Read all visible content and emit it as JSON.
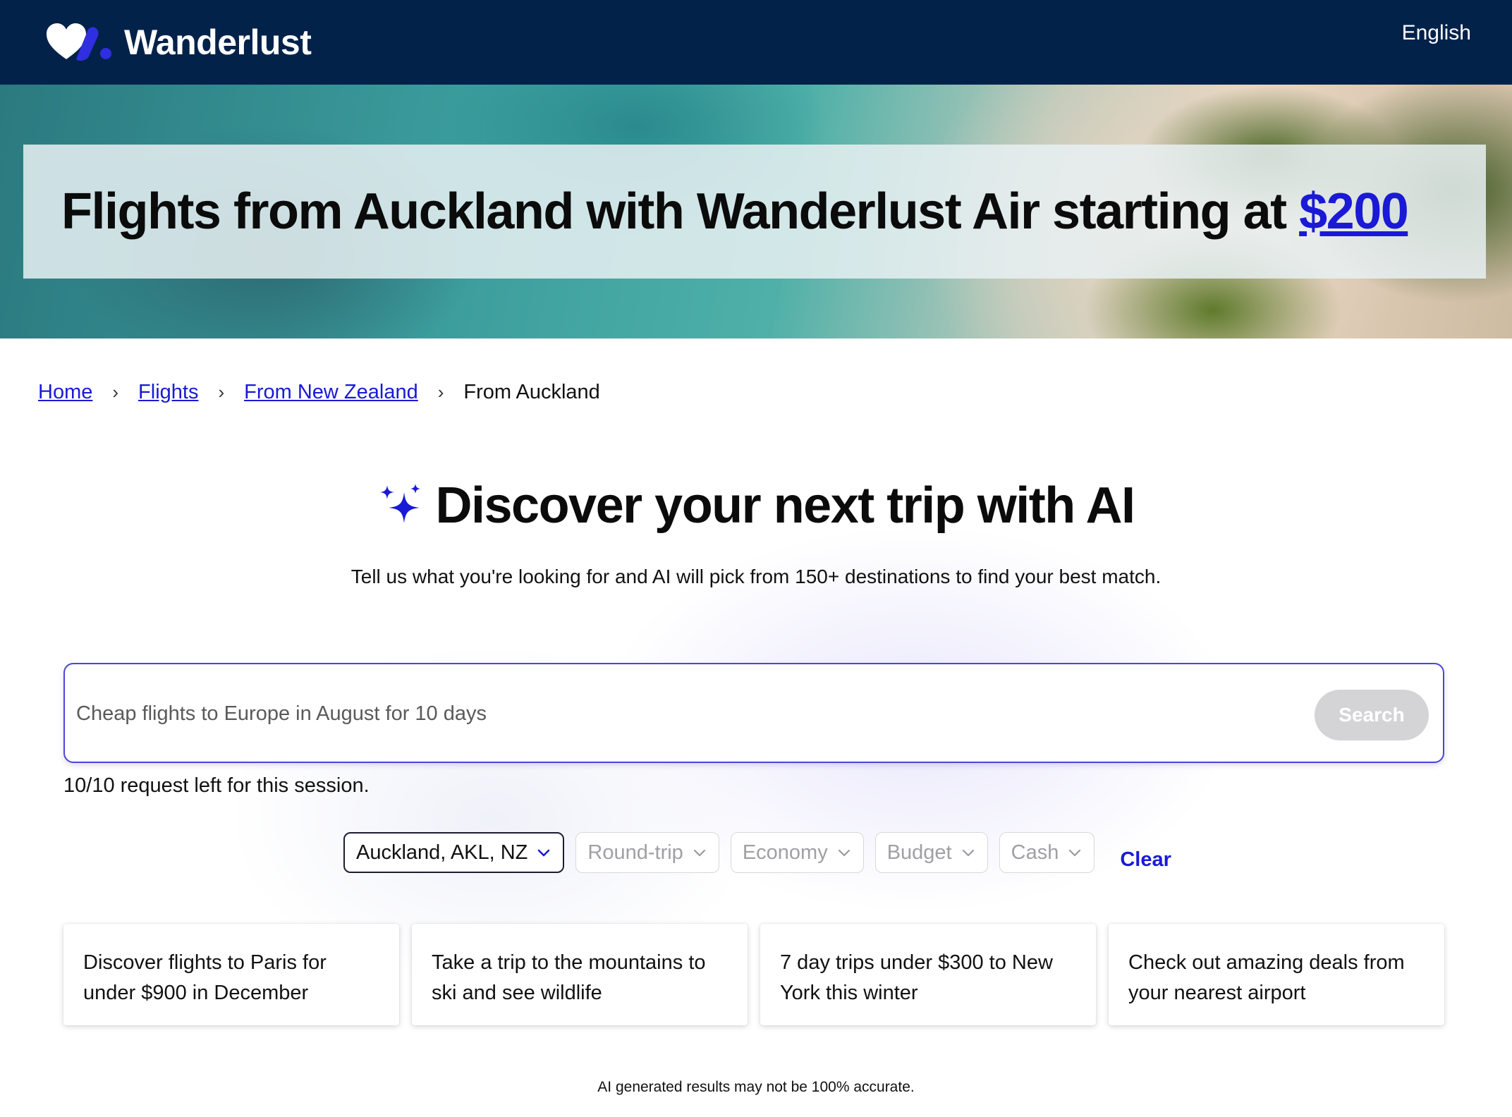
{
  "brand": {
    "name": "Wanderlust",
    "accent": "#1a19d6",
    "nav_bg": "#02224a"
  },
  "nav": {
    "language": "English"
  },
  "hero": {
    "title_prefix": "Flights from Auckland with Wanderlust Air starting at ",
    "price": "$200"
  },
  "breadcrumb": {
    "items": [
      "Home",
      "Flights",
      "From New Zealand"
    ],
    "current": "From Auckland",
    "separator": "›"
  },
  "ai": {
    "title": "Discover your next trip with AI",
    "subtitle": "Tell us what you're looking for and AI will pick from 150+ destinations to find your best match.",
    "search": {
      "placeholder": "Cheap flights to Europe in August for 10 days",
      "value": "",
      "button_label": "Search"
    },
    "session_note": "10/10 request left for this session."
  },
  "filters": {
    "origin": "Auckland, AKL, NZ",
    "trip_type": "Round-trip",
    "cabin": "Economy",
    "budget": "Budget",
    "payment": "Cash",
    "clear_label": "Clear"
  },
  "suggestions": [
    "Discover flights to Paris for under $900 in December",
    "Take a trip to the mountains to ski and see wildlife",
    "7 day trips under $300 to New York this winter",
    "Check out amazing deals from your nearest airport"
  ],
  "disclaimer": "AI generated results may not be 100% accurate."
}
